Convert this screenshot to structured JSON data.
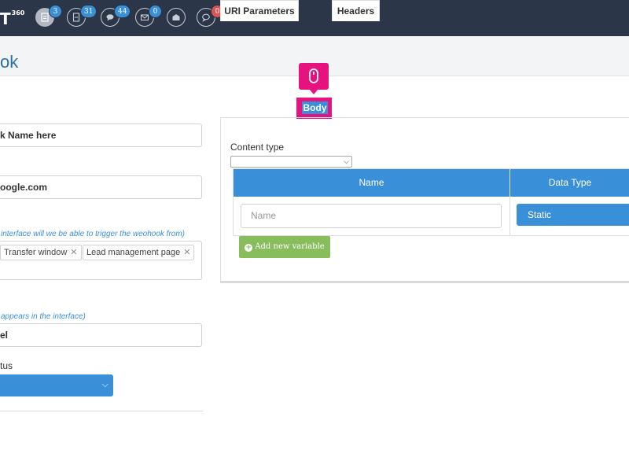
{
  "app": {
    "logo_text": "T",
    "logo_sup": "360"
  },
  "topbar": {
    "badges": [
      "3",
      "31",
      "44",
      "0",
      "0"
    ],
    "badge_alert": "0",
    "colors": {
      "bar": "#2b3648",
      "badge": "#3a8fd9",
      "badge_alert": "#e05252"
    }
  },
  "page": {
    "title": "ok"
  },
  "form": {
    "webhook_name_value": "k Name here",
    "url_value": "oogle.com",
    "trigger_hint": " interface will we be able to trigger the weohook from)",
    "trigger_tags": [
      "Transfer window",
      "Lead management page"
    ],
    "appears_hint": " appears in the interface)",
    "label_value": "el",
    "status_label": "tus"
  },
  "tabs": {
    "uri_parameters": "URI Parameters",
    "body": "Body",
    "headers": "Headers",
    "active": "Body"
  },
  "body_panel": {
    "content_type_label": "Content type",
    "content_type_value": "",
    "table": {
      "headers": [
        "Name",
        "Data Type"
      ],
      "rows": [
        {
          "name_placeholder": "Name",
          "data_type": "Static"
        }
      ]
    },
    "add_variable_label": "Add new variable"
  },
  "colors": {
    "accent": "#3a8fd9",
    "highlight": "#e6127d",
    "add_button": "#88bd5b"
  }
}
